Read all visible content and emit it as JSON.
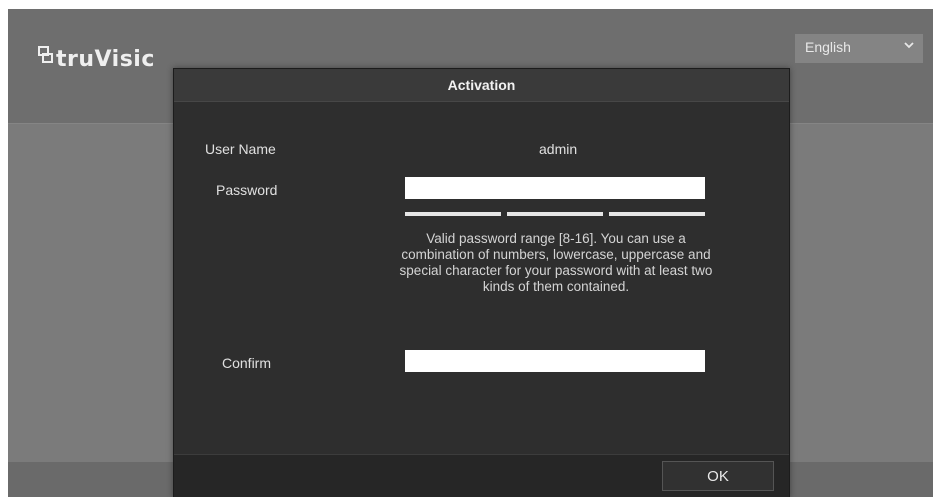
{
  "header": {
    "logo_text": "truVisic",
    "language": {
      "selected": "English",
      "icon": "chevron-down-icon"
    }
  },
  "dialog": {
    "title": "Activation",
    "user_name_label": "User Name",
    "user_name_value": "admin",
    "password_label": "Password",
    "password_value": "",
    "strength_segments": 3,
    "hint": "Valid password range [8-16]. You can use a combination of numbers, lowercase, uppercase and special character for your password with at least two kinds of them contained.",
    "confirm_label": "Confirm",
    "confirm_value": "",
    "ok_label": "OK"
  },
  "colors": {
    "backdrop": "#7b7b7b",
    "dialog_bg": "#2e2e2e",
    "field_bg": "#ffffff",
    "text": "#e0e0e0"
  }
}
